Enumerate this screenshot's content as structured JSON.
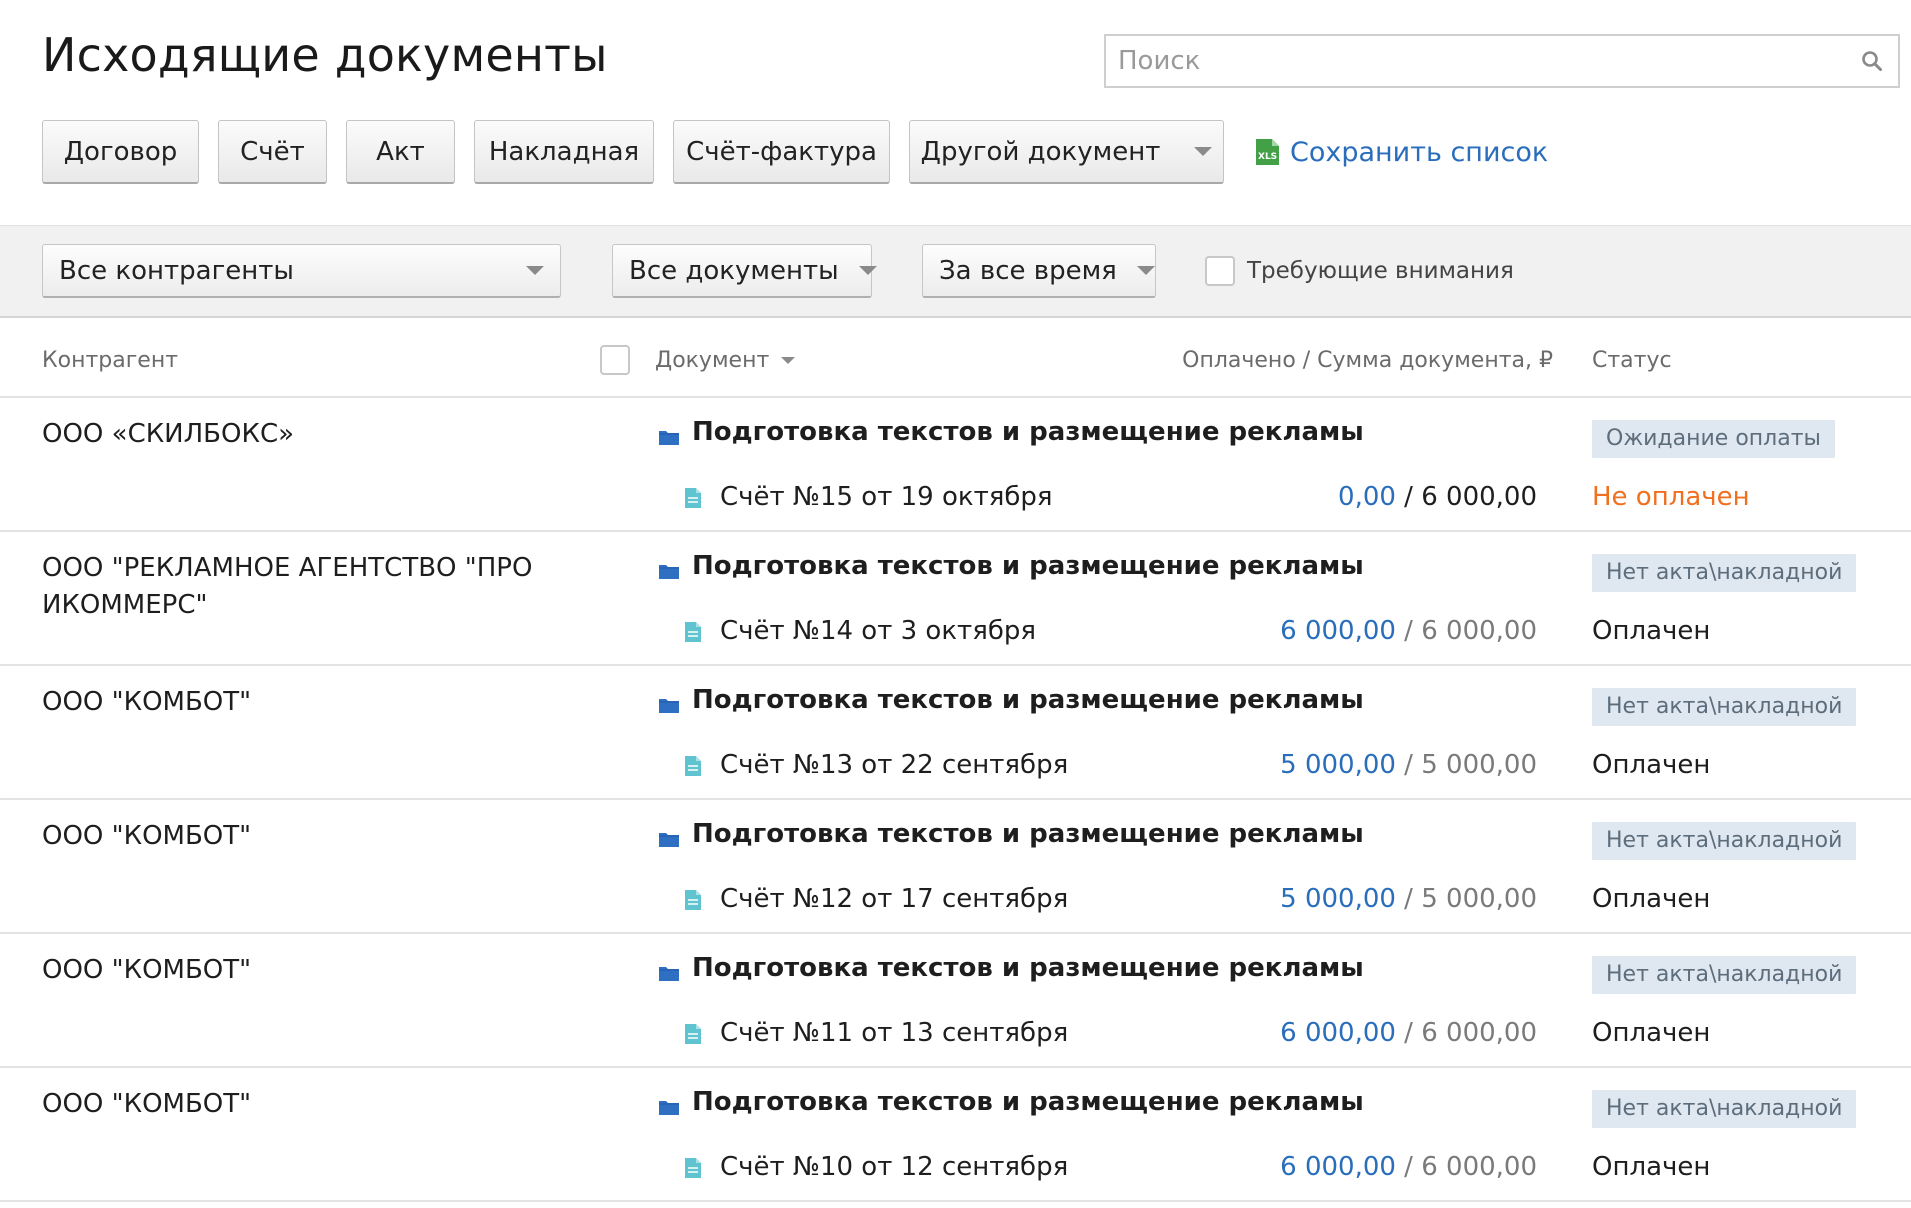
{
  "header": {
    "title": "Исходящие документы",
    "search_placeholder": "Поиск"
  },
  "doc_buttons": [
    {
      "label": "Договор"
    },
    {
      "label": "Счёт"
    },
    {
      "label": "Акт"
    },
    {
      "label": "Накладная"
    },
    {
      "label": "Счёт-фактура"
    },
    {
      "label": "Другой документ"
    }
  ],
  "save_list_label": "Сохранить список",
  "filters": {
    "counterparty": "Все контрагенты",
    "documents": "Все документы",
    "period": "За все время",
    "attention_label": "Требующие внимания"
  },
  "columns": {
    "counterparty": "Контрагент",
    "document": "Документ",
    "amount": "Оплачено / Сумма документа, ₽",
    "status": "Статус"
  },
  "rows": [
    {
      "counterparty": "ООО «СКИЛБОКС»",
      "project": "Подготовка текстов и размещение рекламы",
      "invoice": "Счёт №15 от 19 октября",
      "paid": "0,00",
      "separator": " / ",
      "total": "6 000,00",
      "badge": "Ожидание оплаты",
      "payment_status": "Не оплачен"
    },
    {
      "counterparty": "ООО \"РЕКЛАМНОЕ АГЕНТСТВО \"ПРО ИКОММЕРС\"",
      "project": "Подготовка текстов и размещение рекламы",
      "invoice": "Счёт №14 от 3 октября",
      "paid": "6 000,00",
      "separator": " / ",
      "total": "6 000,00",
      "badge": "Нет акта\\накладной",
      "payment_status": "Оплачен"
    },
    {
      "counterparty": "ООО \"КОМБОТ\"",
      "project": "Подготовка текстов и размещение рекламы",
      "invoice": "Счёт №13 от 22 сентября",
      "paid": "5 000,00",
      "separator": " / ",
      "total": "5 000,00",
      "badge": "Нет акта\\накладной",
      "payment_status": "Оплачен"
    },
    {
      "counterparty": "ООО \"КОМБОТ\"",
      "project": "Подготовка текстов и размещение рекламы",
      "invoice": "Счёт №12 от 17 сентября",
      "paid": "5 000,00",
      "separator": " / ",
      "total": "5 000,00",
      "badge": "Нет акта\\накладной",
      "payment_status": "Оплачен"
    },
    {
      "counterparty": "ООО \"КОМБОТ\"",
      "project": "Подготовка текстов и размещение рекламы",
      "invoice": "Счёт №11 от 13 сентября",
      "paid": "6 000,00",
      "separator": " / ",
      "total": "6 000,00",
      "badge": "Нет акта\\накладной",
      "payment_status": "Оплачен"
    },
    {
      "counterparty": "ООО \"КОМБОТ\"",
      "project": "Подготовка текстов и размещение рекламы",
      "invoice": "Счёт №10 от 12 сентября",
      "paid": "6 000,00",
      "separator": " / ",
      "total": "6 000,00",
      "badge": "Нет акта\\накладной",
      "payment_status": "Оплачен"
    }
  ],
  "icons": {
    "search": "search-icon",
    "xls": "xls-file-icon",
    "folder": "folder-icon",
    "document": "document-icon",
    "dropdown": "chevron-down-icon"
  },
  "colors": {
    "link": "#2a6ebb",
    "unpaid": "#f07020",
    "badge_bg": "#dfe8f1",
    "folder": "#2f6fc2",
    "document_icon": "#5fc4cf",
    "xls_icon": "#43a047"
  }
}
